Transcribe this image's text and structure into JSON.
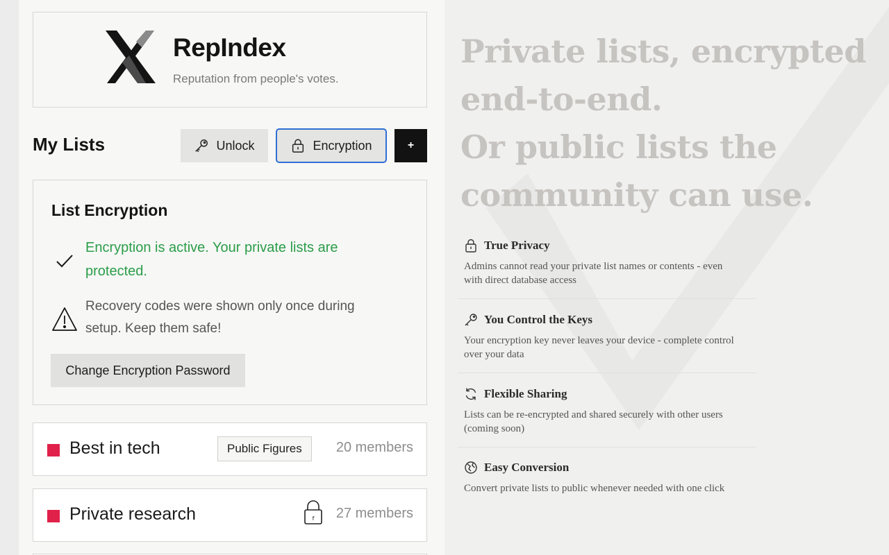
{
  "brand": {
    "name": "RepIndex",
    "tagline": "Reputation from people's votes."
  },
  "lists_header": {
    "title": "My Lists",
    "unlock_label": "Unlock",
    "encryption_label": "Encryption",
    "add_label": "+"
  },
  "encryption_panel": {
    "title": "List Encryption",
    "status": "Encryption is active. Your private lists are protected.",
    "warning": "Recovery codes were shown only once during setup. Keep them safe!",
    "change_password_label": "Change Encryption Password"
  },
  "lists": [
    {
      "name": "Best in tech",
      "tag": "Public Figures",
      "members": "20 members",
      "color": "#e0214a",
      "private": false
    },
    {
      "name": "Private research",
      "tag": "",
      "members": "27 members",
      "color": "#e0214a",
      "private": true
    }
  ],
  "hero": {
    "line1": "Private lists, encrypted end-to-end.",
    "line2": "Or public lists the community can use."
  },
  "features": [
    {
      "icon": "lock-icon",
      "title": "True Privacy",
      "description": "Admins cannot read your private list names or contents - even with direct database access"
    },
    {
      "icon": "key-icon",
      "title": "You Control the Keys",
      "description": "Your encryption key never leaves your device - complete control over your data"
    },
    {
      "icon": "refresh-icon",
      "title": "Flexible Sharing",
      "description": "Lists can be re-encrypted and shared securely with other users (coming soon)"
    },
    {
      "icon": "globe-icon",
      "title": "Easy Conversion",
      "description": "Convert private lists to public whenever needed with one click"
    }
  ],
  "colors": {
    "accent": "#2f6fd6",
    "success": "#2a9d49",
    "list_marker": "#e0214a"
  }
}
